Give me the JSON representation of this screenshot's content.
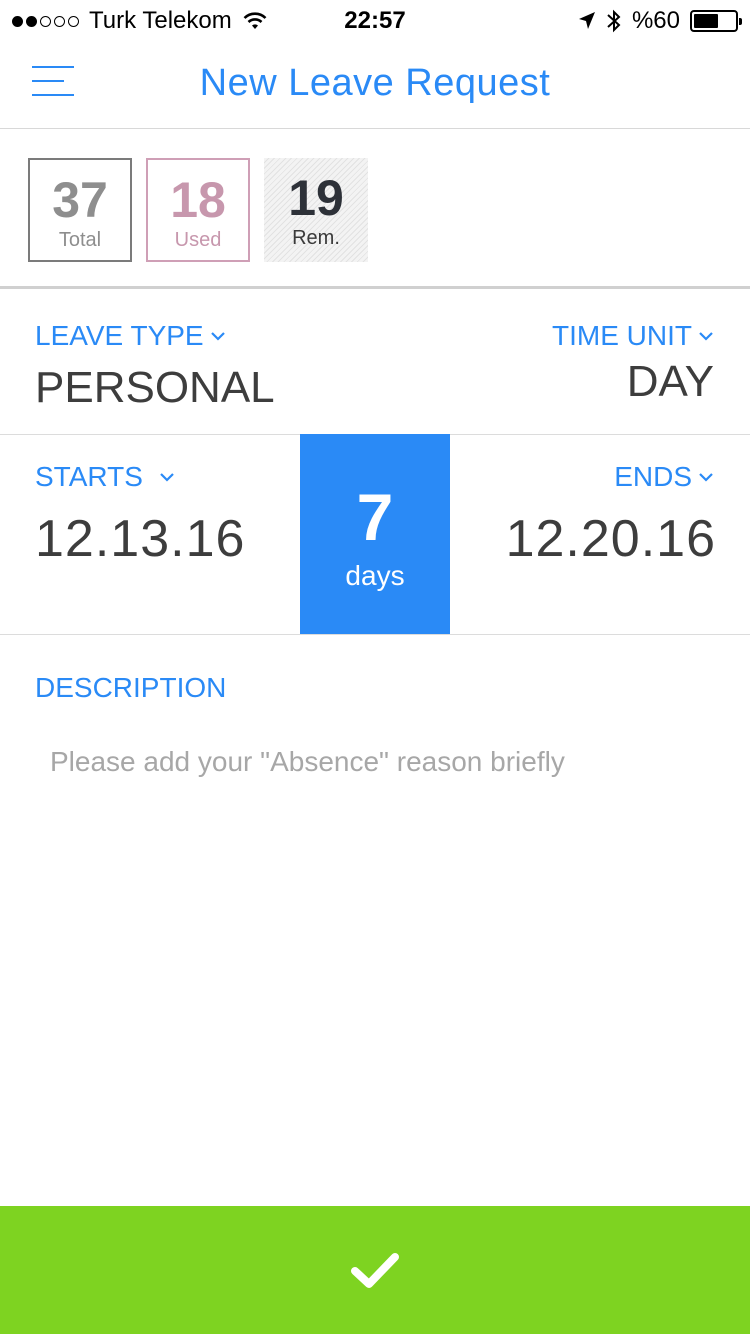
{
  "status_bar": {
    "signal": [
      true,
      true,
      false,
      false,
      false
    ],
    "carrier": "Turk Telekom",
    "time": "22:57",
    "battery_text": "%60",
    "battery_level": 0.6,
    "icons": [
      "wifi-icon",
      "location-icon",
      "bluetooth-icon",
      "battery-icon"
    ]
  },
  "header": {
    "title": "New Leave Request",
    "menu_icon": "hamburger-menu-icon"
  },
  "stats": {
    "total": {
      "value": "37",
      "label": "Total"
    },
    "used": {
      "value": "18",
      "label": "Used"
    },
    "remaining": {
      "value": "19",
      "label": "Rem."
    }
  },
  "leave_type": {
    "label": "LEAVE TYPE",
    "value": "PERSONAL"
  },
  "time_unit": {
    "label": "TIME UNIT",
    "value": "DAY"
  },
  "dates": {
    "starts_label": "STARTS",
    "starts_value": "12.13.16",
    "ends_label": "ENDS",
    "ends_value": "12.20.16",
    "duration_value": "7",
    "duration_unit": "days"
  },
  "description": {
    "label": "DESCRIPTION",
    "value": "",
    "placeholder": "Please add your \"Absence\" reason briefly"
  },
  "submit": {
    "icon": "checkmark-icon"
  },
  "colors": {
    "accent": "#2a8af6",
    "submit": "#7ed321",
    "used": "#c797ad",
    "total": "#8e8e8e"
  }
}
